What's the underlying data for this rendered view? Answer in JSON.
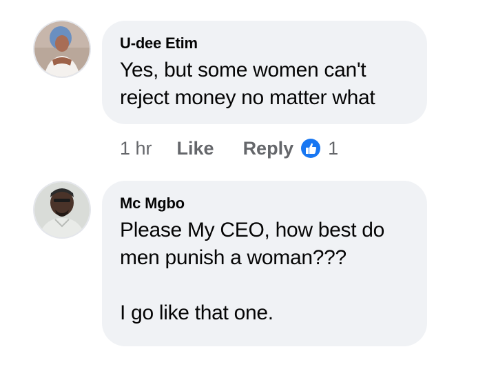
{
  "comments": [
    {
      "author": "U-dee Etim",
      "text": "Yes, but some women can't reject money no matter what",
      "line1": "Yes, but some women can't",
      "line2": "reject money no matter what",
      "time": "1 hr",
      "like_label": "Like",
      "reply_label": "Reply",
      "reaction_count": "1",
      "reaction_icon": "like-reaction-icon"
    },
    {
      "author": "Mc Mgbo",
      "line1": "Please My CEO, how best do",
      "line2": "men punish a woman???",
      "line3": "I go like that one."
    }
  ],
  "colors": {
    "bubble_bg": "#f0f2f5",
    "meta_text": "#65676b",
    "like_blue": "#1877f2"
  }
}
